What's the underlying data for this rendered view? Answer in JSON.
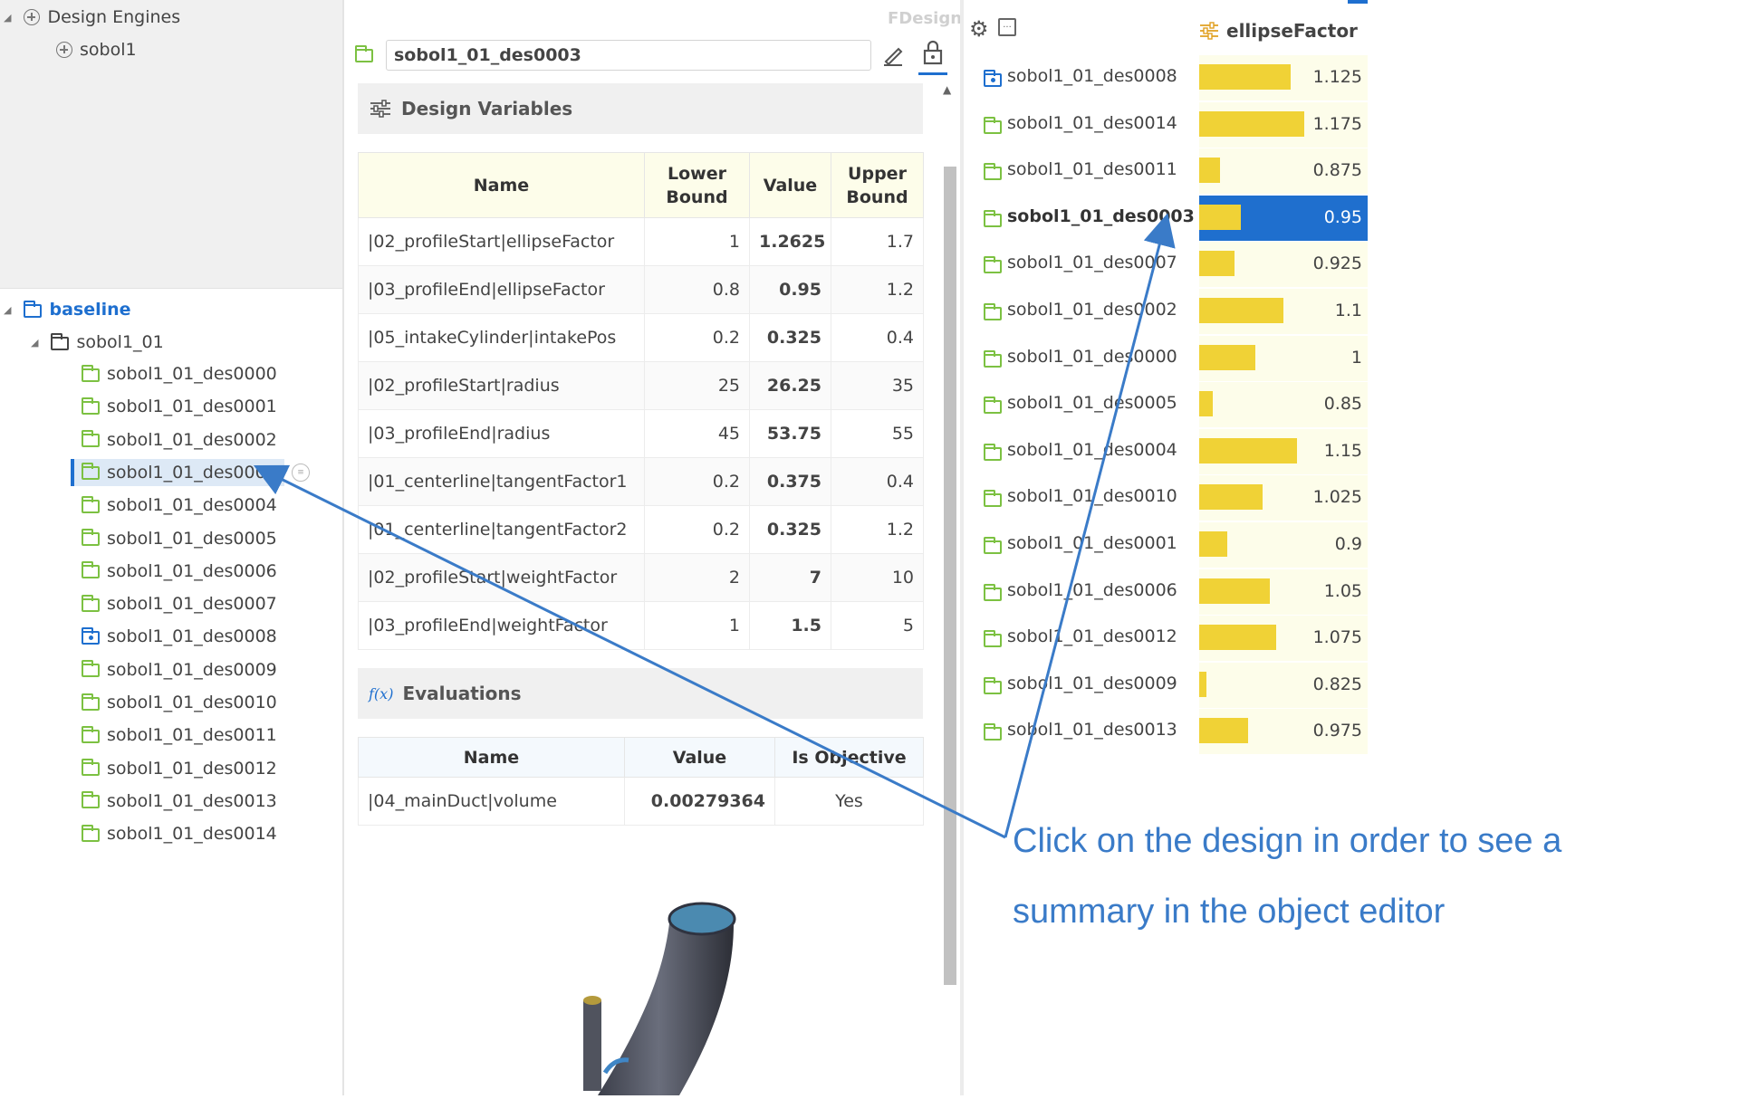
{
  "left_tree": {
    "engines_label": "Design Engines",
    "engine_item": "sobol1",
    "baseline_label": "baseline",
    "group_label": "sobol1_01",
    "designs": [
      "sobol1_01_des0000",
      "sobol1_01_des0001",
      "sobol1_01_des0002",
      "sobol1_01_des0003",
      "sobol1_01_des0004",
      "sobol1_01_des0005",
      "sobol1_01_des0006",
      "sobol1_01_des0007",
      "sobol1_01_des0008",
      "sobol1_01_des0009",
      "sobol1_01_des0010",
      "sobol1_01_des0011",
      "sobol1_01_des0012",
      "sobol1_01_des0013",
      "sobol1_01_des0014"
    ],
    "selected_design": "sobol1_01_des0003"
  },
  "editor": {
    "brand": "FDesign",
    "object_name": "sobol1_01_des0003",
    "design_variables_title": "Design Variables",
    "dv_headers": {
      "name": "Name",
      "lower": "Lower Bound",
      "value": "Value",
      "upper": "Upper Bound"
    },
    "design_variables": [
      {
        "name": "|02_profileStart|ellipseFactor",
        "lower": "1",
        "value": "1.2625",
        "upper": "1.7"
      },
      {
        "name": "|03_profileEnd|ellipseFactor",
        "lower": "0.8",
        "value": "0.95",
        "upper": "1.2"
      },
      {
        "name": "|05_intakeCylinder|intakePos",
        "lower": "0.2",
        "value": "0.325",
        "upper": "0.4"
      },
      {
        "name": "|02_profileStart|radius",
        "lower": "25",
        "value": "26.25",
        "upper": "35"
      },
      {
        "name": "|03_profileEnd|radius",
        "lower": "45",
        "value": "53.75",
        "upper": "55"
      },
      {
        "name": "|01_centerline|tangentFactor1",
        "lower": "0.2",
        "value": "0.375",
        "upper": "0.4"
      },
      {
        "name": "|01_centerline|tangentFactor2",
        "lower": "0.2",
        "value": "0.325",
        "upper": "1.2"
      },
      {
        "name": "|02_profileStart|weightFactor",
        "lower": "2",
        "value": "7",
        "upper": "10"
      },
      {
        "name": "|03_profileEnd|weightFactor",
        "lower": "1",
        "value": "1.5",
        "upper": "5"
      }
    ],
    "evaluations_title": "Evaluations",
    "fx_label": "f(x)",
    "eval_headers": {
      "name": "Name",
      "value": "Value",
      "objective": "Is Objective"
    },
    "evaluations": [
      {
        "name": "|04_mainDuct|volume",
        "value": "0.00279364",
        "objective": "Yes"
      }
    ]
  },
  "results": {
    "column_title": "ellipseFactor",
    "value_range": [
      0.8,
      1.2
    ],
    "rows": [
      {
        "name": "sobol1_01_des0008",
        "value": "1.125",
        "icon": "special"
      },
      {
        "name": "sobol1_01_des0014",
        "value": "1.175"
      },
      {
        "name": "sobol1_01_des0011",
        "value": "0.875"
      },
      {
        "name": "sobol1_01_des0003",
        "value": "0.95",
        "selected": true
      },
      {
        "name": "sobol1_01_des0007",
        "value": "0.925"
      },
      {
        "name": "sobol1_01_des0002",
        "value": "1.1"
      },
      {
        "name": "sobol1_01_des0000",
        "value": "1"
      },
      {
        "name": "sobol1_01_des0005",
        "value": "0.85"
      },
      {
        "name": "sobol1_01_des0004",
        "value": "1.15"
      },
      {
        "name": "sobol1_01_des0010",
        "value": "1.025"
      },
      {
        "name": "sobol1_01_des0001",
        "value": "0.9"
      },
      {
        "name": "sobol1_01_des0006",
        "value": "1.05"
      },
      {
        "name": "sobol1_01_des0012",
        "value": "1.075"
      },
      {
        "name": "sobol1_01_des0009",
        "value": "0.825"
      },
      {
        "name": "sobol1_01_des0013",
        "value": "0.975"
      }
    ]
  },
  "annotation": {
    "line1": "Click on the design in order to see a",
    "line2": "summary in the object editor",
    "color": "#3a7bc8"
  },
  "icons": [
    "plus-circle-icon",
    "folder-icon",
    "chart-circle-icon",
    "sliders-icon",
    "fx-icon",
    "edit-icon",
    "lock-icon",
    "gear-icon",
    "expand-icon",
    "scroll-up-icon"
  ]
}
